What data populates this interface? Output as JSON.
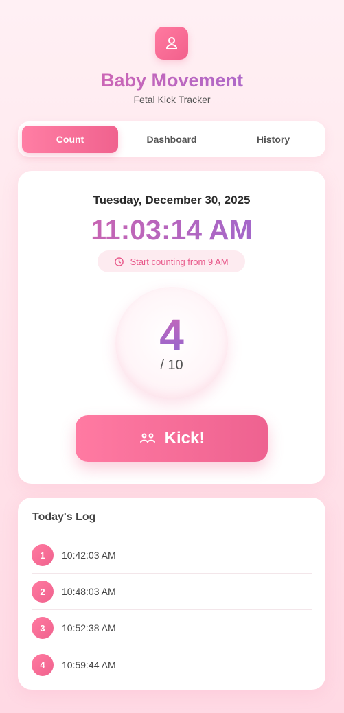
{
  "header": {
    "icon": "baby-icon",
    "title": "Baby Movement",
    "subtitle": "Fetal Kick Tracker"
  },
  "tabs": [
    {
      "label": "Count",
      "active": true
    },
    {
      "label": "Dashboard",
      "active": false
    },
    {
      "label": "History",
      "active": false
    }
  ],
  "counter": {
    "date": "Tuesday, December 30, 2025",
    "time": "11:03:14 AM",
    "hint_icon": "clock-icon",
    "hint": "Start counting from 9 AM",
    "count": "4",
    "goal": "/ 10",
    "kick_icon": "footprints-icon",
    "kick_label": "Kick!"
  },
  "log": {
    "title": "Today's Log",
    "entries": [
      {
        "n": "1",
        "time": "10:42:03 AM"
      },
      {
        "n": "2",
        "time": "10:48:03 AM"
      },
      {
        "n": "3",
        "time": "10:52:38 AM"
      },
      {
        "n": "4",
        "time": "10:59:44 AM"
      }
    ]
  },
  "colors": {
    "accent": "#f0628e",
    "accent_light": "#ff7aa0",
    "gradient_purple": "#9a6ad6",
    "background": "#ffe3ea"
  }
}
